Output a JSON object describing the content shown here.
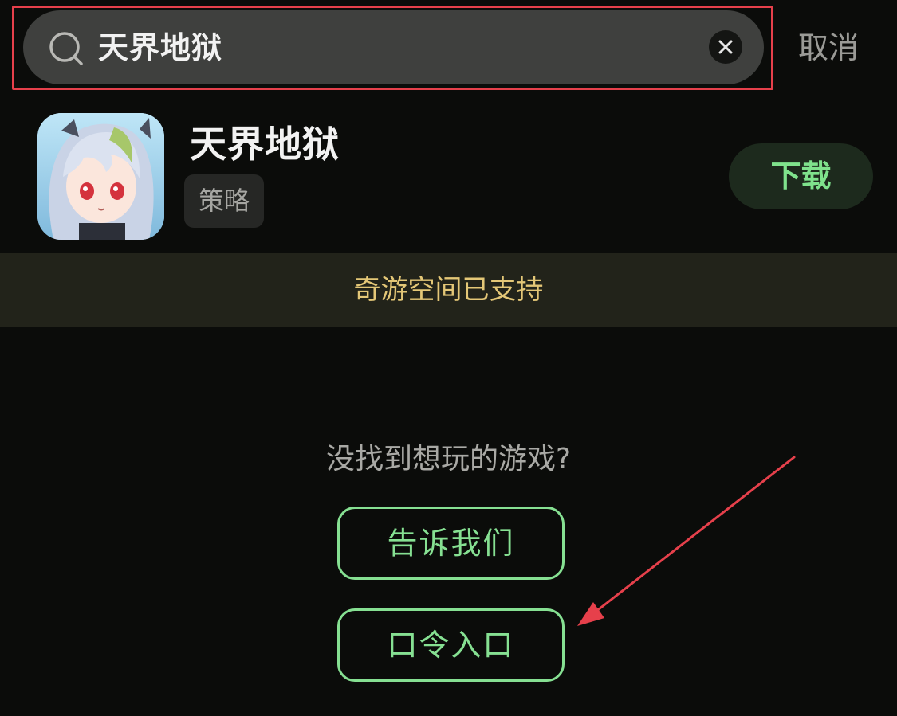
{
  "search": {
    "query": "天界地狱",
    "cancel_label": "取消",
    "search_icon": "search-icon",
    "clear_icon": "close-icon"
  },
  "result": {
    "name": "天界地狱",
    "tag": "策略",
    "download_label": "下载"
  },
  "banner": {
    "text": "奇游空间已支持"
  },
  "feedback": {
    "prompt": "没找到想玩的游戏?",
    "tell_us_label": "告诉我们",
    "code_entry_label": "口令入口"
  },
  "colors": {
    "background": "#0b0c0a",
    "accent_green": "#86e092",
    "banner_text": "#e4c777",
    "annotation_red": "#e6404b"
  }
}
